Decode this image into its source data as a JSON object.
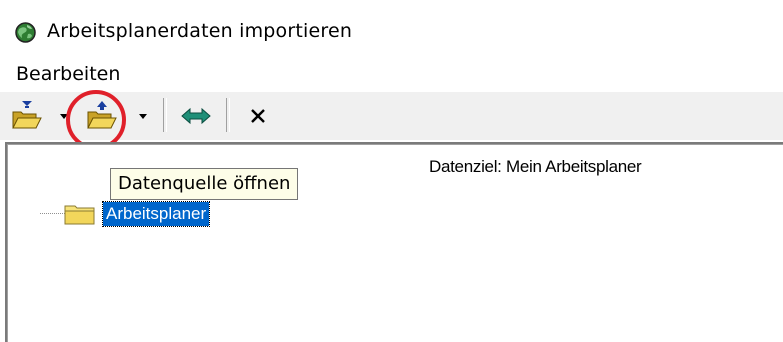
{
  "window": {
    "title": "Arbeitsplanerdaten  importieren",
    "icon": "globe-icon"
  },
  "menu": {
    "items": [
      {
        "label": "Bearbeiten"
      }
    ]
  },
  "toolbar": {
    "buttons": [
      {
        "name": "open-destination-button",
        "icon": "folder-open-blue-down-icon",
        "has_dropdown": true
      },
      {
        "name": "open-source-button",
        "icon": "folder-open-blue-up-icon",
        "has_dropdown": true
      },
      {
        "name": "swap-button",
        "icon": "double-arrow-icon"
      },
      {
        "name": "close-button",
        "icon": "close-icon"
      }
    ]
  },
  "tooltip": {
    "text": "Datenquelle öffnen"
  },
  "main": {
    "destination_label": "Datenziel: Mein Arbeitsplaner",
    "tree": [
      {
        "label": "Arbeitsplaner",
        "selected": true,
        "icon": "folder-icon"
      }
    ]
  },
  "colors": {
    "highlight_circle": "#e0202a",
    "selection": "#0066cc",
    "toolbar_bg": "#f0f0f0",
    "tooltip_bg": "#fdfde8"
  }
}
